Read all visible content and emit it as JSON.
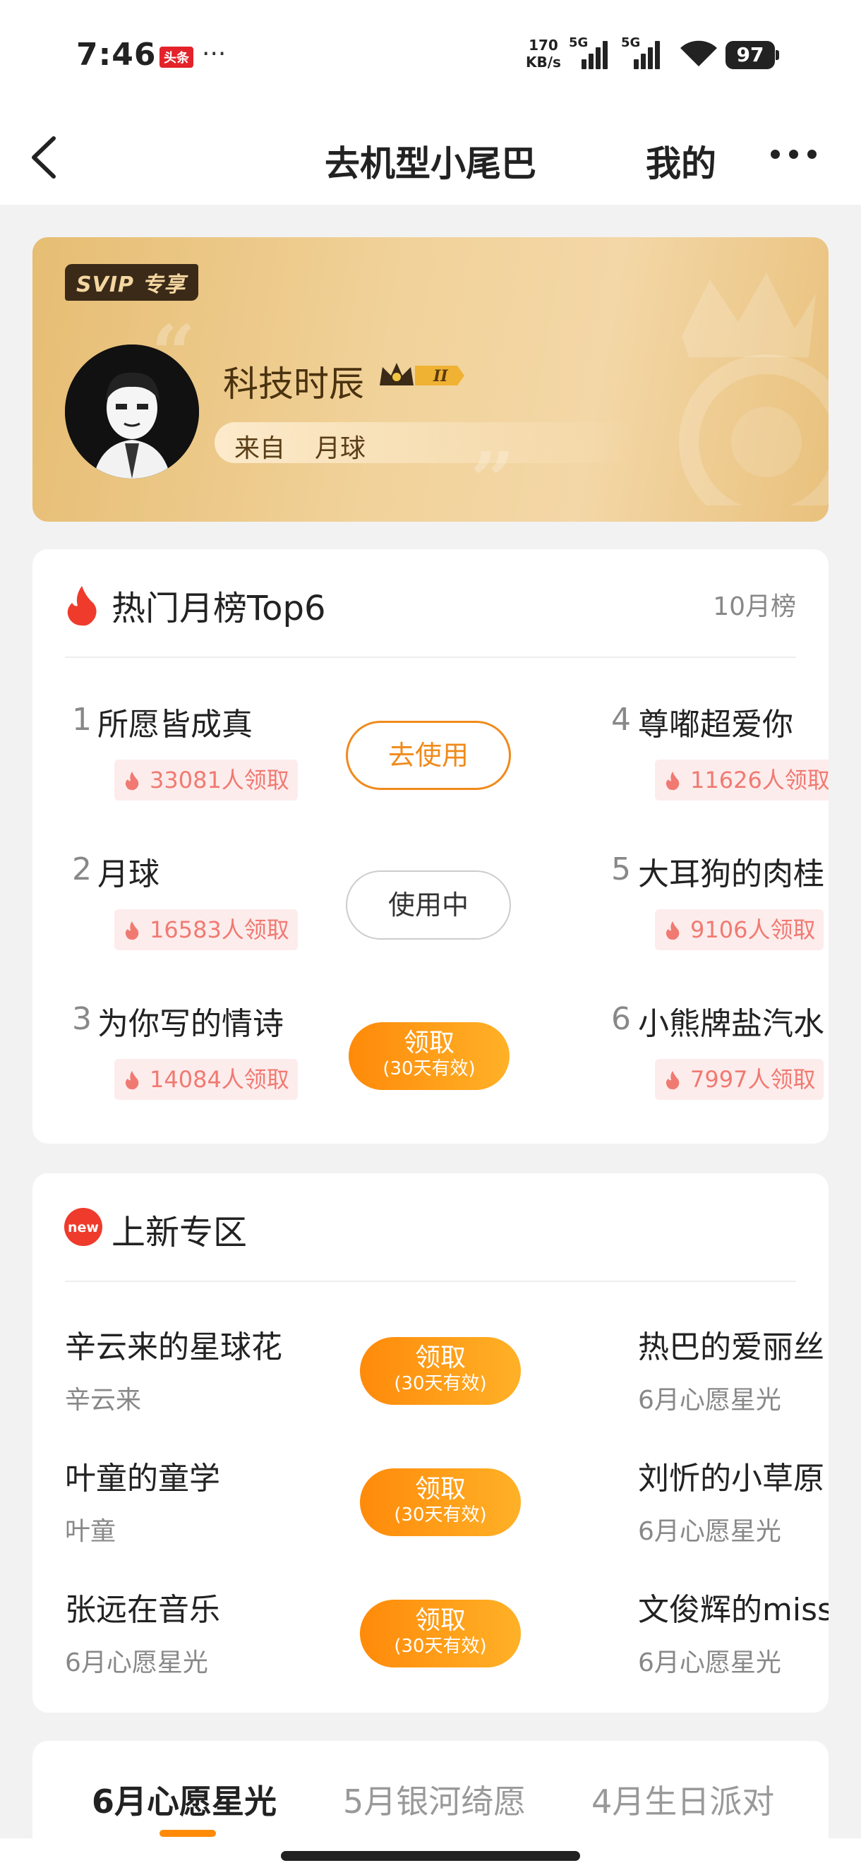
{
  "status_bar": {
    "time": "7:46",
    "app_badge": "头条",
    "more": "···",
    "net_speed_value": "170",
    "net_speed_unit": "KB/s",
    "sig1_label": "5G",
    "sig2_label": "5G",
    "battery": "97"
  },
  "nav": {
    "title": "去机型小尾巴",
    "mine": "我的"
  },
  "profile": {
    "badge": "SVIP 专享",
    "name": "科技时辰",
    "vip_level": "II",
    "from_label": "来自",
    "from_value": "月球"
  },
  "hot": {
    "title": "热门月榜Top6",
    "period": "10月榜",
    "items": [
      {
        "rank": "1",
        "name": "所愿皆成真",
        "count": "33081人领取"
      },
      {
        "rank": "2",
        "name": "月球",
        "count": "16583人领取"
      },
      {
        "rank": "3",
        "name": "为你写的情诗",
        "count": "14084人领取"
      },
      {
        "rank": "4",
        "name": "尊嘟超爱你",
        "count": "11626人领取"
      },
      {
        "rank": "5",
        "name": "大耳狗的肉桂",
        "count": "9106人领取"
      },
      {
        "rank": "6",
        "name": "小熊牌盐汽水",
        "count": "7997人领取"
      }
    ],
    "btn_use": "去使用",
    "btn_in_use": "使用中",
    "btn_claim": "领取",
    "btn_claim_sub": "(30天有效)"
  },
  "new_zone": {
    "title": "上新专区",
    "new_badge": "new",
    "items": [
      {
        "name": "辛云来的星球花",
        "sub": "辛云来"
      },
      {
        "name": "叶童的童学",
        "sub": "叶童"
      },
      {
        "name": "张远在音乐",
        "sub": "6月心愿星光"
      },
      {
        "name": "热巴的爱丽丝",
        "sub": "6月心愿星光"
      },
      {
        "name": "刘忻的小草原",
        "sub": "6月心愿星光"
      },
      {
        "name": "文俊辉的miss",
        "sub": "6月心愿星光"
      }
    ],
    "btn_claim": "领取",
    "btn_claim_sub": "(30天有效)"
  },
  "tabs": [
    {
      "label": "6月心愿星光"
    },
    {
      "label": "5月银河绮愿"
    },
    {
      "label": "4月生日派对"
    }
  ],
  "colors": {
    "accent": "#ff8a0a",
    "gold": "#e6bd73",
    "count_bg": "#fdecec",
    "count_text": "#f07a72"
  }
}
